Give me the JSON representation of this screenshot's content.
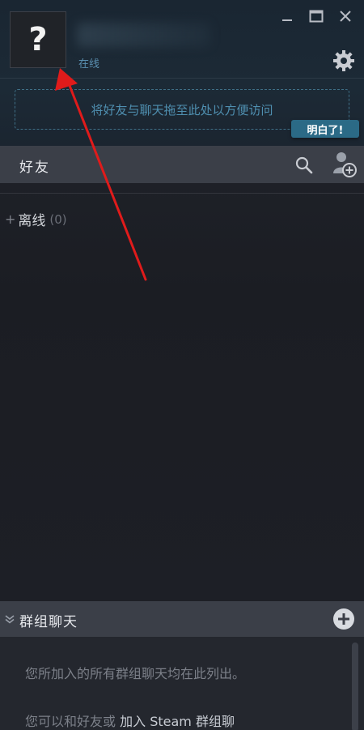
{
  "header": {
    "avatar_glyph": "?",
    "status": "在线",
    "window_controls": {
      "minimize": "minimize-icon",
      "maximize": "maximize-icon",
      "close": "close-icon"
    },
    "settings_icon": "gear-icon",
    "drop_zone_text": "将好友与聊天拖至此处以方便访问",
    "got_it_label": "明白了!"
  },
  "friends": {
    "title": "好友",
    "search_icon": "search-icon",
    "add_friend_icon": "add-friend-icon",
    "groups": [
      {
        "plus": "+",
        "label": "离线",
        "count": "(0)"
      }
    ]
  },
  "group_chats": {
    "title": "群组聊天",
    "add_icon": "add-group-icon",
    "empty_line1": "您所加入的所有群组聊天均在此列出。",
    "empty_line2_prefix": "您可以和好友或",
    "empty_line2_link": "加入 Steam 群组聊"
  },
  "colors": {
    "accent": "#2b6a86",
    "arrow": "#e01b1b",
    "bar_bg": "#3b3f48",
    "window_bg": "#1d1f25"
  }
}
